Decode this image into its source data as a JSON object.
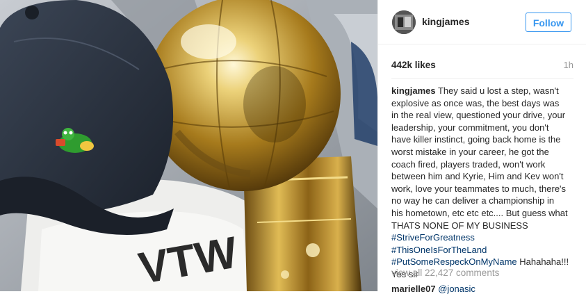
{
  "post": {
    "author": {
      "username": "kingjames"
    },
    "follow_label": "Follow",
    "likes": "442k likes",
    "age": "1h",
    "caption": {
      "username": "kingjames",
      "lines": [
        "They said u lost a step, wasn't",
        "explosive as once was, the best days was",
        "in the real view, questioned your drive, your",
        "leadership, your commitment, you don't",
        "have killer instinct, going back home is the",
        "worst mistake in your career, he got the",
        "coach fired, players traded, won't work",
        "between him and Kyrie, Him and Kev won't",
        "work, love your teammates to much, there's",
        "no way he can deliver a championship in",
        "his hometown, etc etc etc.... But guess what",
        "THATS NONE OF MY BUSINESS"
      ],
      "hashtags": [
        "#StriveForGreatness",
        "#ThisOneIsForTheLand",
        "#PutSomeRespeckOnMyName"
      ],
      "after_last_hashtag": " Hahahaha!!!",
      "closing": "Yes sir"
    },
    "view_all": "view all 22,427 comments",
    "next_comment": {
      "username": "marielle07",
      "mention": "@jonasic"
    },
    "photo": {
      "shirt_print": "VTW",
      "trophy_color": "#c9a23a",
      "cap_color": "#2b3340"
    },
    "colors": {
      "link": "#003569",
      "accent": "#3897f0",
      "muted": "#999999"
    }
  }
}
